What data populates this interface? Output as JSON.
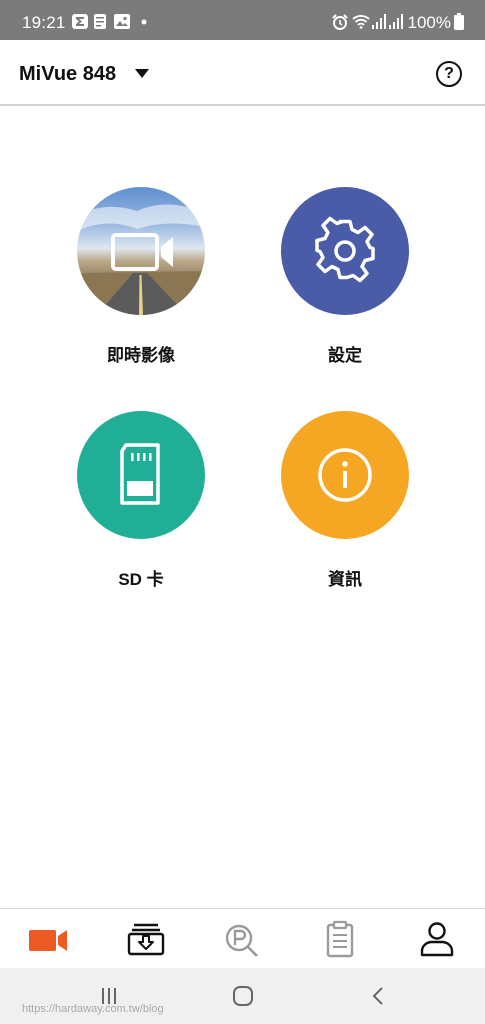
{
  "status_bar": {
    "time": "19:21",
    "battery": "100%",
    "icons": [
      "sigma-icon",
      "notification-icon",
      "image-icon",
      "dot-icon",
      "alarm-icon",
      "wifi-icon",
      "signal-icon",
      "signal-icon",
      "battery-icon"
    ]
  },
  "header": {
    "device_name": "MiVue 848",
    "help_label": "?"
  },
  "menu": {
    "live_view": {
      "label": "即時影像",
      "icon": "video-camera-icon"
    },
    "settings": {
      "label": "設定",
      "icon": "gear-icon"
    },
    "sd_card": {
      "label": "SD 卡",
      "icon": "sd-card-icon"
    },
    "info": {
      "label": "資訊",
      "icon": "info-icon"
    }
  },
  "bottom_nav": {
    "items": [
      {
        "name": "camera",
        "icon": "video-camera-icon",
        "active": true
      },
      {
        "name": "download",
        "icon": "download-box-icon",
        "active": false
      },
      {
        "name": "parking-search",
        "icon": "parking-search-icon",
        "active": false
      },
      {
        "name": "clipboard",
        "icon": "clipboard-icon",
        "active": false
      },
      {
        "name": "profile",
        "icon": "user-icon",
        "active": false
      }
    ]
  },
  "system_nav": [
    "recent-apps-icon",
    "home-icon",
    "back-icon"
  ],
  "watermark": "https://hardaway.com.tw/blog",
  "colors": {
    "accent": "#ee5a24",
    "settings": "#4a5ba8",
    "sd_card": "#20ae96",
    "info": "#f5a623",
    "status_bar": "#7b7b7b"
  }
}
